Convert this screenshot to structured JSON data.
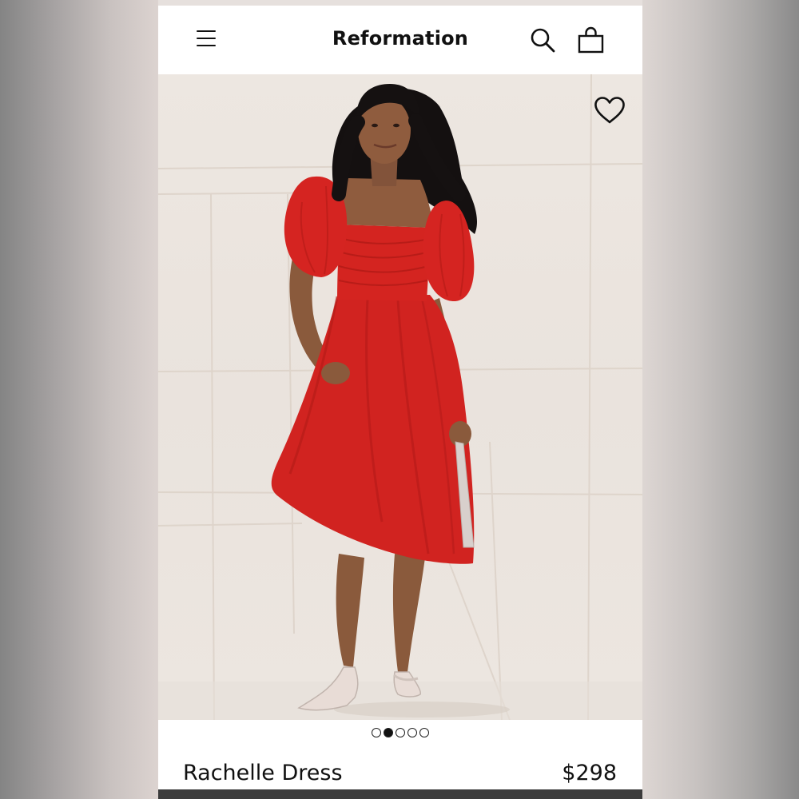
{
  "header": {
    "brand": "Reformation",
    "menu_icon": "hamburger-menu-icon",
    "search_icon": "search-icon",
    "bag_icon": "shopping-bag-icon"
  },
  "hero": {
    "favorite_icon": "heart-icon",
    "image_subject": "model-in-red-dress-photo"
  },
  "carousel": {
    "total": 5,
    "active_index": 1
  },
  "product": {
    "name": "Rachelle Dress",
    "price": "$298"
  },
  "colors": {
    "dress": "#d5201c",
    "background": "#ece6e0",
    "text": "#111111"
  }
}
